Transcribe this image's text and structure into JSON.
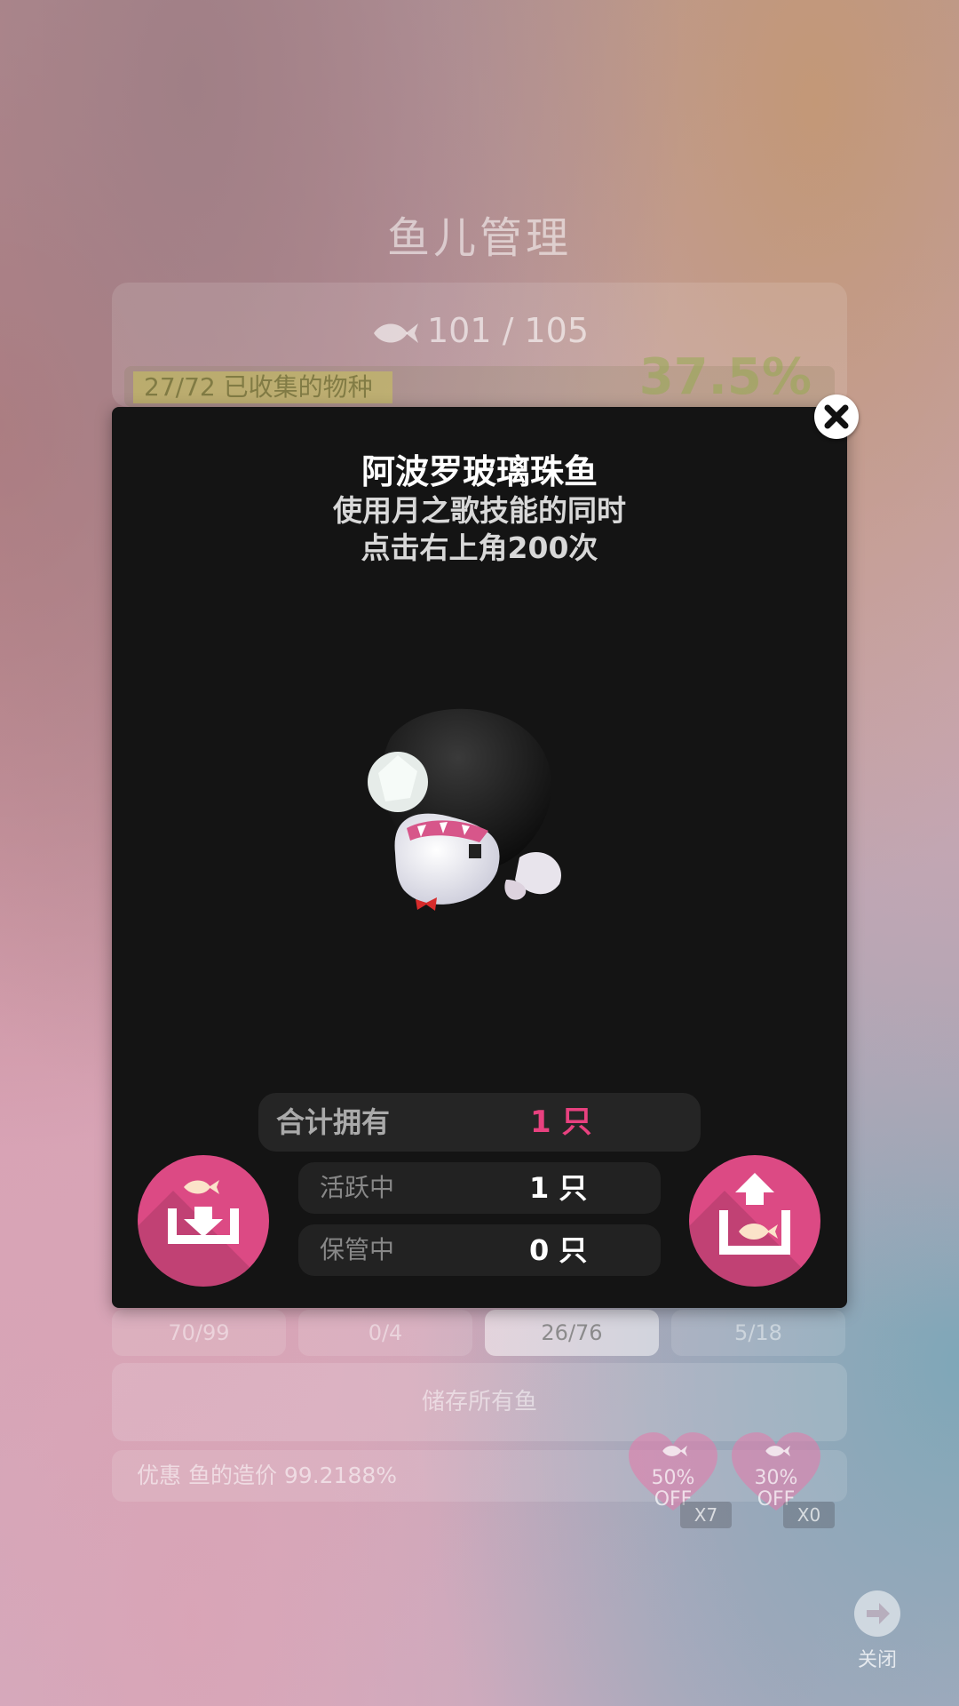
{
  "background": {
    "title": "鱼儿管理",
    "fish_count": "101 / 105",
    "species_collected": "27/72 已收集的物种",
    "species_progress": 0.375,
    "collection_percent": "37.5%",
    "tabs": [
      {
        "label": "70/99",
        "active": false
      },
      {
        "label": "0/4",
        "active": false
      },
      {
        "label": "26/76",
        "active": true
      },
      {
        "label": "5/18",
        "active": false
      }
    ],
    "store_all_button": "储存所有鱼",
    "discount_text": "优惠 鱼的造价 99.2188%",
    "coupons": [
      {
        "discount": "50%",
        "off": "OFF",
        "count": "X7"
      },
      {
        "discount": "30%",
        "off": "OFF",
        "count": "X0"
      }
    ],
    "close_label": "关闭"
  },
  "modal": {
    "fish_name": "阿波罗玻璃珠鱼",
    "desc_line1": "使用月之歌技能的同时",
    "desc_line2": "点击右上角200次",
    "total_label": "合计拥有",
    "total_value": "1 只",
    "active_label": "活跃中",
    "active_value": "1 只",
    "stored_label": "保管中",
    "stored_value": "0 只"
  },
  "colors": {
    "accent": "#dc4a84",
    "modal_bg": "#141414",
    "total_value": "#e8417f"
  },
  "icons": [
    "fish-icon",
    "close-icon",
    "store-fish-icon",
    "release-fish-icon",
    "arrow-right-icon"
  ]
}
